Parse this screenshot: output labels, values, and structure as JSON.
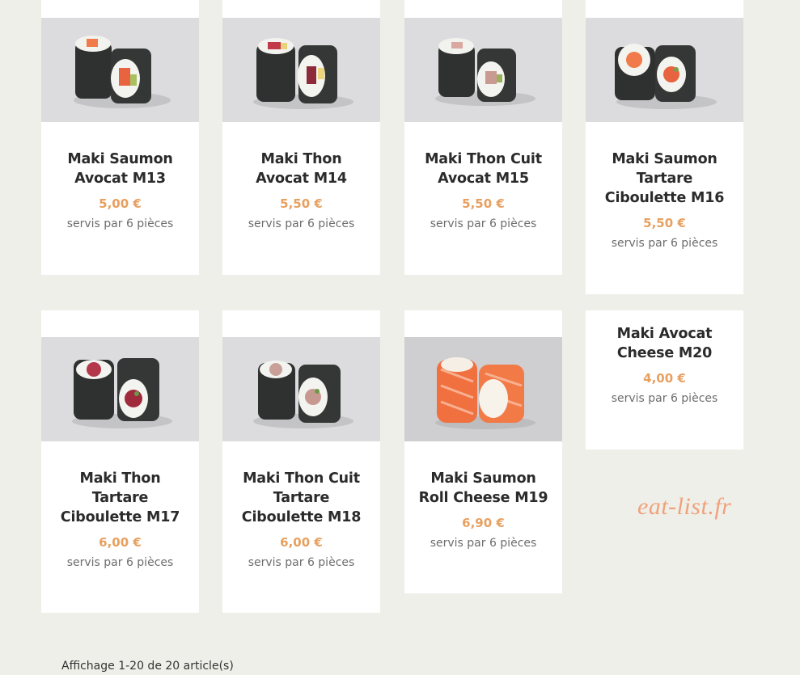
{
  "colors": {
    "background": "#efefea",
    "card": "#ffffff",
    "title": "#2b2b2b",
    "price": "#e8a060",
    "subtitle": "#6d6d6d",
    "watermark": "#f0a17a"
  },
  "products": [
    {
      "name": "Maki Saumon Avocat M13",
      "price": "5,00 €",
      "serving": "servis par 6 pièces",
      "image": "maki-salmon-avocado-image"
    },
    {
      "name": "Maki Thon Avocat M14",
      "price": "5,50 €",
      "serving": "servis par 6 pièces",
      "image": "maki-tuna-avocado-image"
    },
    {
      "name": "Maki Thon Cuit Avocat M15",
      "price": "5,50 €",
      "serving": "servis par 6 pièces",
      "image": "maki-cooked-tuna-avocado-image"
    },
    {
      "name": "Maki Saumon Tartare Ciboulette M16",
      "price": "5,50 €",
      "serving": "servis par 6 pièces",
      "image": "maki-salmon-tartare-image"
    },
    {
      "name": "Maki Thon Tartare Ciboulette M17",
      "price": "6,00 €",
      "serving": "servis par 6 pièces",
      "image": "maki-tuna-tartare-image"
    },
    {
      "name": "Maki Thon Cuit Tartare Ciboulette M18",
      "price": "6,00 €",
      "serving": "servis par 6 pièces",
      "image": "maki-cooked-tuna-tartare-image"
    },
    {
      "name": "Maki Saumon Roll Cheese M19",
      "price": "6,90 €",
      "serving": "servis par 6 pièces",
      "image": "maki-salmon-roll-cheese-image"
    },
    {
      "name": "Maki Avocat Cheese M20",
      "price": "4,00 €",
      "serving": "servis par 6 pièces",
      "image": ""
    }
  ],
  "watermark": "eat-list.fr",
  "pagination": "Affichage 1-20 de 20 article(s)"
}
